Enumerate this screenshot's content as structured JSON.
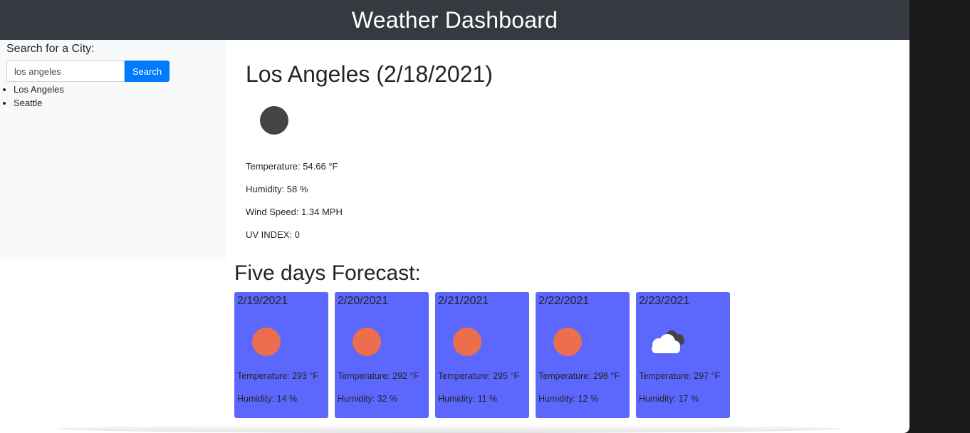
{
  "header": {
    "title": "Weather Dashboard"
  },
  "sidebar": {
    "search_label": "Search for a City:",
    "search_value": "los angeles",
    "search_button": "Search",
    "history": [
      "Los Angeles",
      "Seattle"
    ]
  },
  "current": {
    "title": "Los Angeles (2/18/2021)",
    "icon": "moon-icon",
    "temperature": "Temperature: 54.66 °F",
    "humidity": "Humidity: 58 %",
    "wind": "Wind Speed: 1.34 MPH",
    "uv": "UV INDEX: 0"
  },
  "forecast": {
    "title": "Five days Forecast:",
    "days": [
      {
        "date": "2/19/2021",
        "icon": "sun-icon",
        "temp": "Temperature: 293 °F",
        "humidity": "Humidity: 14 %"
      },
      {
        "date": "2/20/2021",
        "icon": "sun-icon",
        "temp": "Temperature: 292 °F",
        "humidity": "Humidity: 32 %"
      },
      {
        "date": "2/21/2021",
        "icon": "sun-icon",
        "temp": "Temperature: 295 °F",
        "humidity": "Humidity: 11 %"
      },
      {
        "date": "2/22/2021",
        "icon": "sun-icon",
        "temp": "Temperature: 298 °F",
        "humidity": "Humidity: 12 %"
      },
      {
        "date": "2/23/2021",
        "icon": "clouds-icon",
        "temp": "Temperature: 297 °F",
        "humidity": "Humidity: 17 %"
      }
    ]
  },
  "colors": {
    "header_bg": "#343a40",
    "button_bg": "#007bff",
    "card_bg": "#5c67fd",
    "sun": "#ec6e4c",
    "moon": "#444444"
  }
}
